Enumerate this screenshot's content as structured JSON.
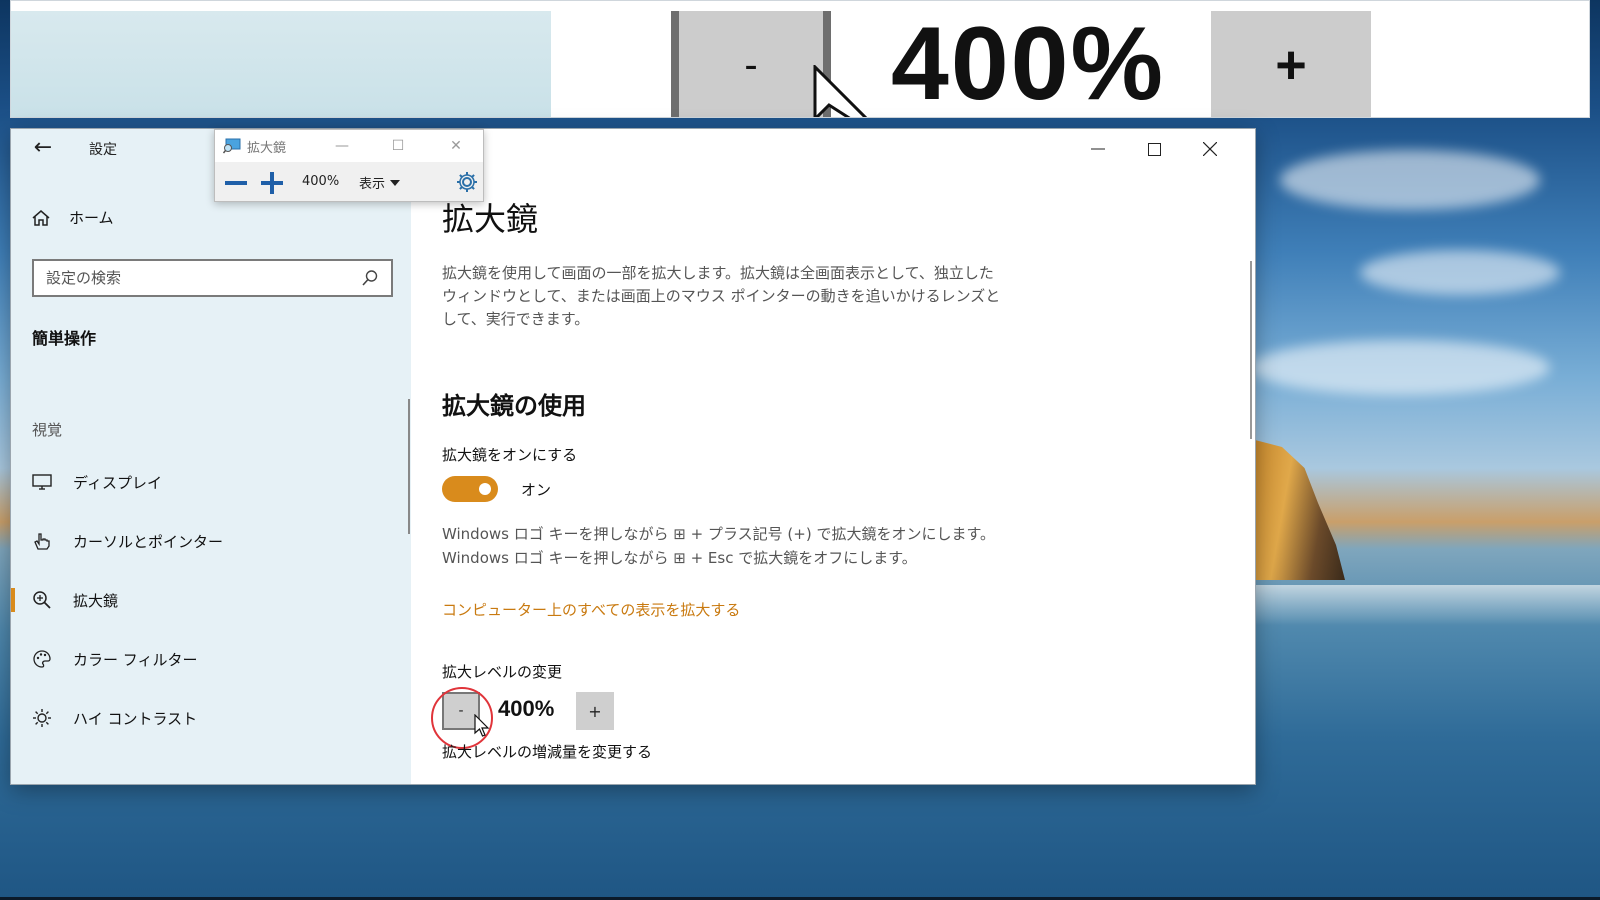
{
  "magnified_view": {
    "minus_label": "-",
    "zoom_text": "400%",
    "plus_label": "+"
  },
  "magnifier_toolbar": {
    "title": "拡大鏡",
    "zoom_text": "400%",
    "view_label": "表示",
    "icons": {
      "app": "magnifier-app-icon",
      "zoom_out": "minus-icon",
      "zoom_in": "plus-icon",
      "settings": "gear-icon"
    }
  },
  "settings_window": {
    "title": "設定",
    "sidebar": {
      "home_label": "ホーム",
      "search_placeholder": "設定の検索",
      "category": "簡単操作",
      "group": "視覚",
      "items": [
        {
          "label": "ディスプレイ",
          "icon": "display-icon",
          "active": false
        },
        {
          "label": "カーソルとポインター",
          "icon": "pointer-icon",
          "active": false
        },
        {
          "label": "拡大鏡",
          "icon": "magnifier-icon",
          "active": true
        },
        {
          "label": "カラー フィルター",
          "icon": "palette-icon",
          "active": false
        },
        {
          "label": "ハイ コントラスト",
          "icon": "brightness-icon",
          "active": false
        }
      ]
    },
    "content": {
      "page_title": "拡大鏡",
      "description": "拡大鏡を使用して画面の一部を拡大します。拡大鏡は全画面表示として、独立したウィンドウとして、または画面上のマウス ポインターの動きを追いかけるレンズとして、実行できます。",
      "section_title": "拡大鏡の使用",
      "toggle_label": "拡大鏡をオンにする",
      "toggle_state": "オン",
      "hint_on": "Windows ロゴ キーを押しながら ⊞ + プラス記号 (+) で拡大鏡をオンにします。",
      "hint_off": "Windows ロゴ キーを押しながら ⊞ + Esc で拡大鏡をオフにします。",
      "link": "コンピューター上のすべての表示を拡大する",
      "zoom_label": "拡大レベルの変更",
      "zoom_minus": "-",
      "zoom_value": "400%",
      "zoom_plus": "+",
      "increment_label": "拡大レベルの増減量を変更する"
    }
  },
  "colors": {
    "accent": "#d98b1c",
    "sidebar_bg": "#e6f1f6",
    "link": "#c97a10",
    "click_ring": "#e0343a"
  }
}
